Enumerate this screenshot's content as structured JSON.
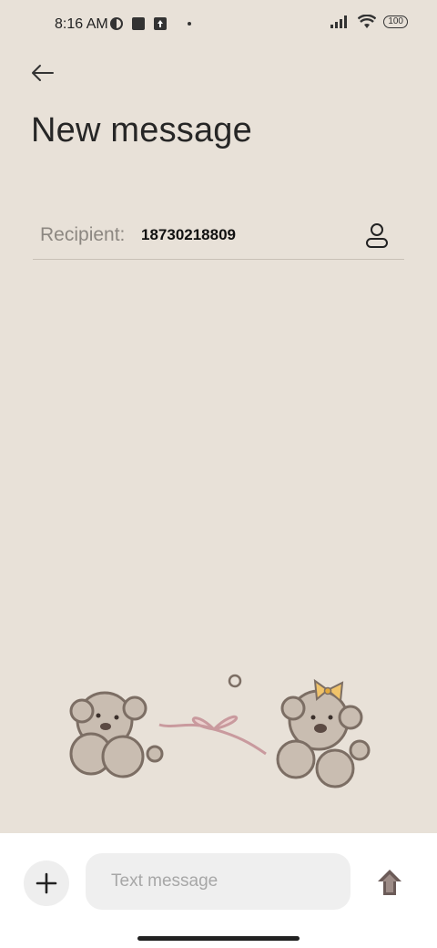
{
  "status_bar": {
    "time": "8:16 AM",
    "battery": "100"
  },
  "header": {
    "back_label": "back",
    "title": "New message"
  },
  "recipient": {
    "label": "Recipient:",
    "value": "18730218809"
  },
  "compose": {
    "placeholder": "Text message"
  },
  "colors": {
    "background": "#e8e1d8",
    "bottom_bar": "#ffffff",
    "input_bg": "#efefef",
    "send_icon": "#6b5b58"
  },
  "icons": [
    "back-arrow-icon",
    "contact-icon",
    "plus-icon",
    "send-arrow-icon",
    "signal-icon",
    "wifi-icon"
  ]
}
